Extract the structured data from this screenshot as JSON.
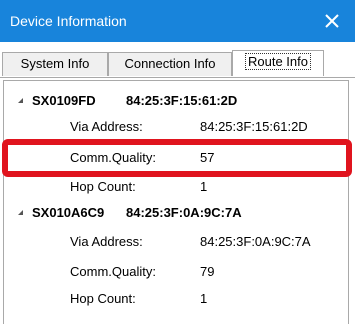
{
  "window": {
    "title": "Device Information",
    "close_icon": "close-icon"
  },
  "tabs": [
    {
      "label": "System Info",
      "active": false
    },
    {
      "label": "Connection Info",
      "active": false
    },
    {
      "label": "Route Info",
      "active": true
    }
  ],
  "devices": [
    {
      "id": "SX0109FD",
      "mac": "84:25:3F:15:61:2D",
      "expanded": true,
      "rows": [
        {
          "key": "Via Address:",
          "value": "84:25:3F:15:61:2D"
        },
        {
          "key": "Comm.Quality:",
          "value": "57"
        },
        {
          "key": "Hop Count:",
          "value": "1"
        }
      ]
    },
    {
      "id": "SX010A6C9",
      "mac": "84:25:3F:0A:9C:7A",
      "expanded": true,
      "rows": [
        {
          "key": "Via Address:",
          "value": "84:25:3F:0A:9C:7A"
        },
        {
          "key": "Comm.Quality:",
          "value": "79"
        },
        {
          "key": "Hop Count:",
          "value": "1"
        }
      ]
    }
  ],
  "colors": {
    "titlebar": "#1884db",
    "highlight": "#e0141e"
  }
}
